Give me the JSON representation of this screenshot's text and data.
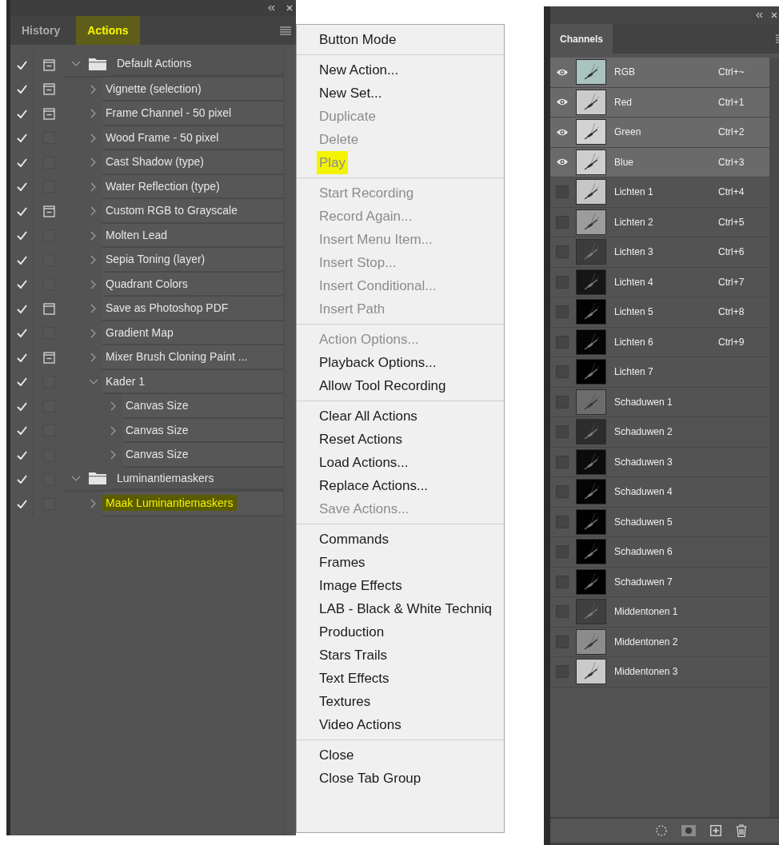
{
  "actions_panel": {
    "tabs": [
      {
        "label": "History",
        "selected": false,
        "highlighted": false
      },
      {
        "label": "Actions",
        "selected": true,
        "highlighted": true
      }
    ],
    "items": [
      {
        "name": "Default Actions",
        "checked": true,
        "dialog": true,
        "dialog_mixed": false,
        "expanded": true,
        "highlighted": false,
        "children": [
          {
            "name": "Vignette (selection)",
            "checked": true,
            "dialog": true,
            "dialog_mixed": false,
            "expanded": false,
            "highlighted": false
          },
          {
            "name": "Frame Channel - 50 pixel",
            "checked": true,
            "dialog": true,
            "dialog_mixed": false,
            "expanded": false,
            "highlighted": false
          },
          {
            "name": "Wood Frame - 50 pixel",
            "checked": true,
            "dialog": false,
            "expanded": false,
            "highlighted": false
          },
          {
            "name": "Cast Shadow (type)",
            "checked": true,
            "dialog": false,
            "expanded": false,
            "highlighted": false
          },
          {
            "name": "Water Reflection (type)",
            "checked": true,
            "dialog": false,
            "expanded": false,
            "highlighted": false
          },
          {
            "name": "Custom RGB to Grayscale",
            "checked": true,
            "dialog": true,
            "dialog_mixed": false,
            "expanded": false,
            "highlighted": false
          },
          {
            "name": "Molten Lead",
            "checked": true,
            "dialog": false,
            "expanded": false,
            "highlighted": false
          },
          {
            "name": "Sepia Toning (layer)",
            "checked": true,
            "dialog": false,
            "expanded": false,
            "highlighted": false
          },
          {
            "name": "Quadrant Colors",
            "checked": true,
            "dialog": false,
            "expanded": false,
            "highlighted": false
          },
          {
            "name": "Save as Photoshop PDF",
            "checked": true,
            "dialog": true,
            "dialog_mixed": true,
            "expanded": false,
            "highlighted": false
          },
          {
            "name": "Gradient Map",
            "checked": true,
            "dialog": false,
            "expanded": false,
            "highlighted": false
          },
          {
            "name": "Mixer Brush Cloning Paint ...",
            "checked": true,
            "dialog": true,
            "dialog_mixed": false,
            "expanded": false,
            "highlighted": false
          },
          {
            "name": "Kader 1",
            "checked": true,
            "dialog": false,
            "expanded": true,
            "highlighted": false,
            "children": [
              {
                "name": "Canvas Size",
                "checked": true,
                "dialog": false,
                "expanded": false,
                "highlighted": false
              },
              {
                "name": "Canvas Size",
                "checked": true,
                "dialog": false,
                "expanded": false,
                "highlighted": false
              },
              {
                "name": "Canvas Size",
                "checked": true,
                "dialog": false,
                "expanded": false,
                "highlighted": false
              }
            ]
          }
        ]
      },
      {
        "name": "Luminantiemaskers",
        "checked": true,
        "dialog": false,
        "expanded": true,
        "highlighted": false,
        "children": [
          {
            "name": "Maak Luminantiemaskers",
            "checked": true,
            "dialog": false,
            "expanded": false,
            "highlighted": true
          }
        ]
      }
    ]
  },
  "panel_menu": {
    "groups": [
      [
        {
          "label": "Button Mode",
          "disabled": false,
          "highlighted": false
        }
      ],
      [
        {
          "label": "New Action...",
          "disabled": false,
          "highlighted": false
        },
        {
          "label": "New Set...",
          "disabled": false,
          "highlighted": false
        },
        {
          "label": "Duplicate",
          "disabled": true,
          "highlighted": false
        },
        {
          "label": "Delete",
          "disabled": true,
          "highlighted": false
        },
        {
          "label": "Play",
          "disabled": true,
          "highlighted": true
        }
      ],
      [
        {
          "label": "Start Recording",
          "disabled": true,
          "highlighted": false
        },
        {
          "label": "Record Again...",
          "disabled": true,
          "highlighted": false
        },
        {
          "label": "Insert Menu Item...",
          "disabled": true,
          "highlighted": false
        },
        {
          "label": "Insert Stop...",
          "disabled": true,
          "highlighted": false
        },
        {
          "label": "Insert Conditional...",
          "disabled": true,
          "highlighted": false
        },
        {
          "label": "Insert Path",
          "disabled": true,
          "highlighted": false
        }
      ],
      [
        {
          "label": "Action Options...",
          "disabled": true,
          "highlighted": false
        },
        {
          "label": "Playback Options...",
          "disabled": false,
          "highlighted": false
        },
        {
          "label": "Allow Tool Recording",
          "disabled": false,
          "highlighted": false
        }
      ],
      [
        {
          "label": "Clear All Actions",
          "disabled": false,
          "highlighted": false
        },
        {
          "label": "Reset Actions",
          "disabled": false,
          "highlighted": false
        },
        {
          "label": "Load Actions...",
          "disabled": false,
          "highlighted": false
        },
        {
          "label": "Replace Actions...",
          "disabled": false,
          "highlighted": false
        },
        {
          "label": "Save Actions...",
          "disabled": true,
          "highlighted": false
        }
      ],
      [
        {
          "label": "Commands",
          "disabled": false,
          "highlighted": false
        },
        {
          "label": "Frames",
          "disabled": false,
          "highlighted": false
        },
        {
          "label": "Image Effects",
          "disabled": false,
          "highlighted": false
        },
        {
          "label": "LAB - Black & White Techniq",
          "disabled": false,
          "highlighted": false
        },
        {
          "label": "Production",
          "disabled": false,
          "highlighted": false
        },
        {
          "label": "Stars Trails",
          "disabled": false,
          "highlighted": false
        },
        {
          "label": "Text Effects",
          "disabled": false,
          "highlighted": false
        },
        {
          "label": "Textures",
          "disabled": false,
          "highlighted": false
        },
        {
          "label": "Video Actions",
          "disabled": false,
          "highlighted": false
        }
      ],
      [
        {
          "label": "Close",
          "disabled": false,
          "highlighted": false
        },
        {
          "label": "Close Tab Group",
          "disabled": false,
          "highlighted": false
        }
      ]
    ]
  },
  "channels_panel": {
    "tabs": [
      {
        "label": "Channels",
        "selected": true
      }
    ],
    "channels": [
      {
        "name": "RGB",
        "shortcut": "Ctrl+~",
        "visible": true,
        "selected": true,
        "color": "#a9c3be"
      },
      {
        "name": "Red",
        "shortcut": "Ctrl+1",
        "visible": true,
        "selected": true,
        "color": "#cbcbcb"
      },
      {
        "name": "Green",
        "shortcut": "Ctrl+2",
        "visible": true,
        "selected": true,
        "color": "#d3d3d3"
      },
      {
        "name": "Blue",
        "shortcut": "Ctrl+3",
        "visible": true,
        "selected": true,
        "color": "#cecece"
      },
      {
        "name": "Lichten 1",
        "shortcut": "Ctrl+4",
        "visible": false,
        "selected": false,
        "color": "#c6c6c6"
      },
      {
        "name": "Lichten 2",
        "shortcut": "Ctrl+5",
        "visible": false,
        "selected": false,
        "color": "#9c9c9c"
      },
      {
        "name": "Lichten 3",
        "shortcut": "Ctrl+6",
        "visible": false,
        "selected": false,
        "color": "#3c3c3c"
      },
      {
        "name": "Lichten 4",
        "shortcut": "Ctrl+7",
        "visible": false,
        "selected": false,
        "color": "#161616"
      },
      {
        "name": "Lichten 5",
        "shortcut": "Ctrl+8",
        "visible": false,
        "selected": false,
        "color": "#030303"
      },
      {
        "name": "Lichten 6",
        "shortcut": "Ctrl+9",
        "visible": false,
        "selected": false,
        "color": "#050505"
      },
      {
        "name": "Lichten 7",
        "visible": false,
        "selected": false,
        "color": "#010101"
      },
      {
        "name": "Schaduwen 1",
        "visible": false,
        "selected": false,
        "color": "#6c6c6c"
      },
      {
        "name": "Schaduwen 2",
        "visible": false,
        "selected": false,
        "color": "#2c2c2c"
      },
      {
        "name": "Schaduwen 3",
        "visible": false,
        "selected": false,
        "color": "#0b0b0b"
      },
      {
        "name": "Schaduwen 4",
        "visible": false,
        "selected": false,
        "color": "#040404"
      },
      {
        "name": "Schaduwen 5",
        "visible": false,
        "selected": false,
        "color": "#020202"
      },
      {
        "name": "Schaduwen 6",
        "visible": false,
        "selected": false,
        "color": "#010101"
      },
      {
        "name": "Schaduwen 7",
        "visible": false,
        "selected": false,
        "color": "#000000"
      },
      {
        "name": "Middentonen 1",
        "visible": false,
        "selected": false,
        "color": "#3f3f3f"
      },
      {
        "name": "Middentonen 2",
        "visible": false,
        "selected": false,
        "color": "#8c8c8c"
      },
      {
        "name": "Middentonen 3",
        "visible": false,
        "selected": false,
        "color": "#cacaca"
      }
    ]
  }
}
